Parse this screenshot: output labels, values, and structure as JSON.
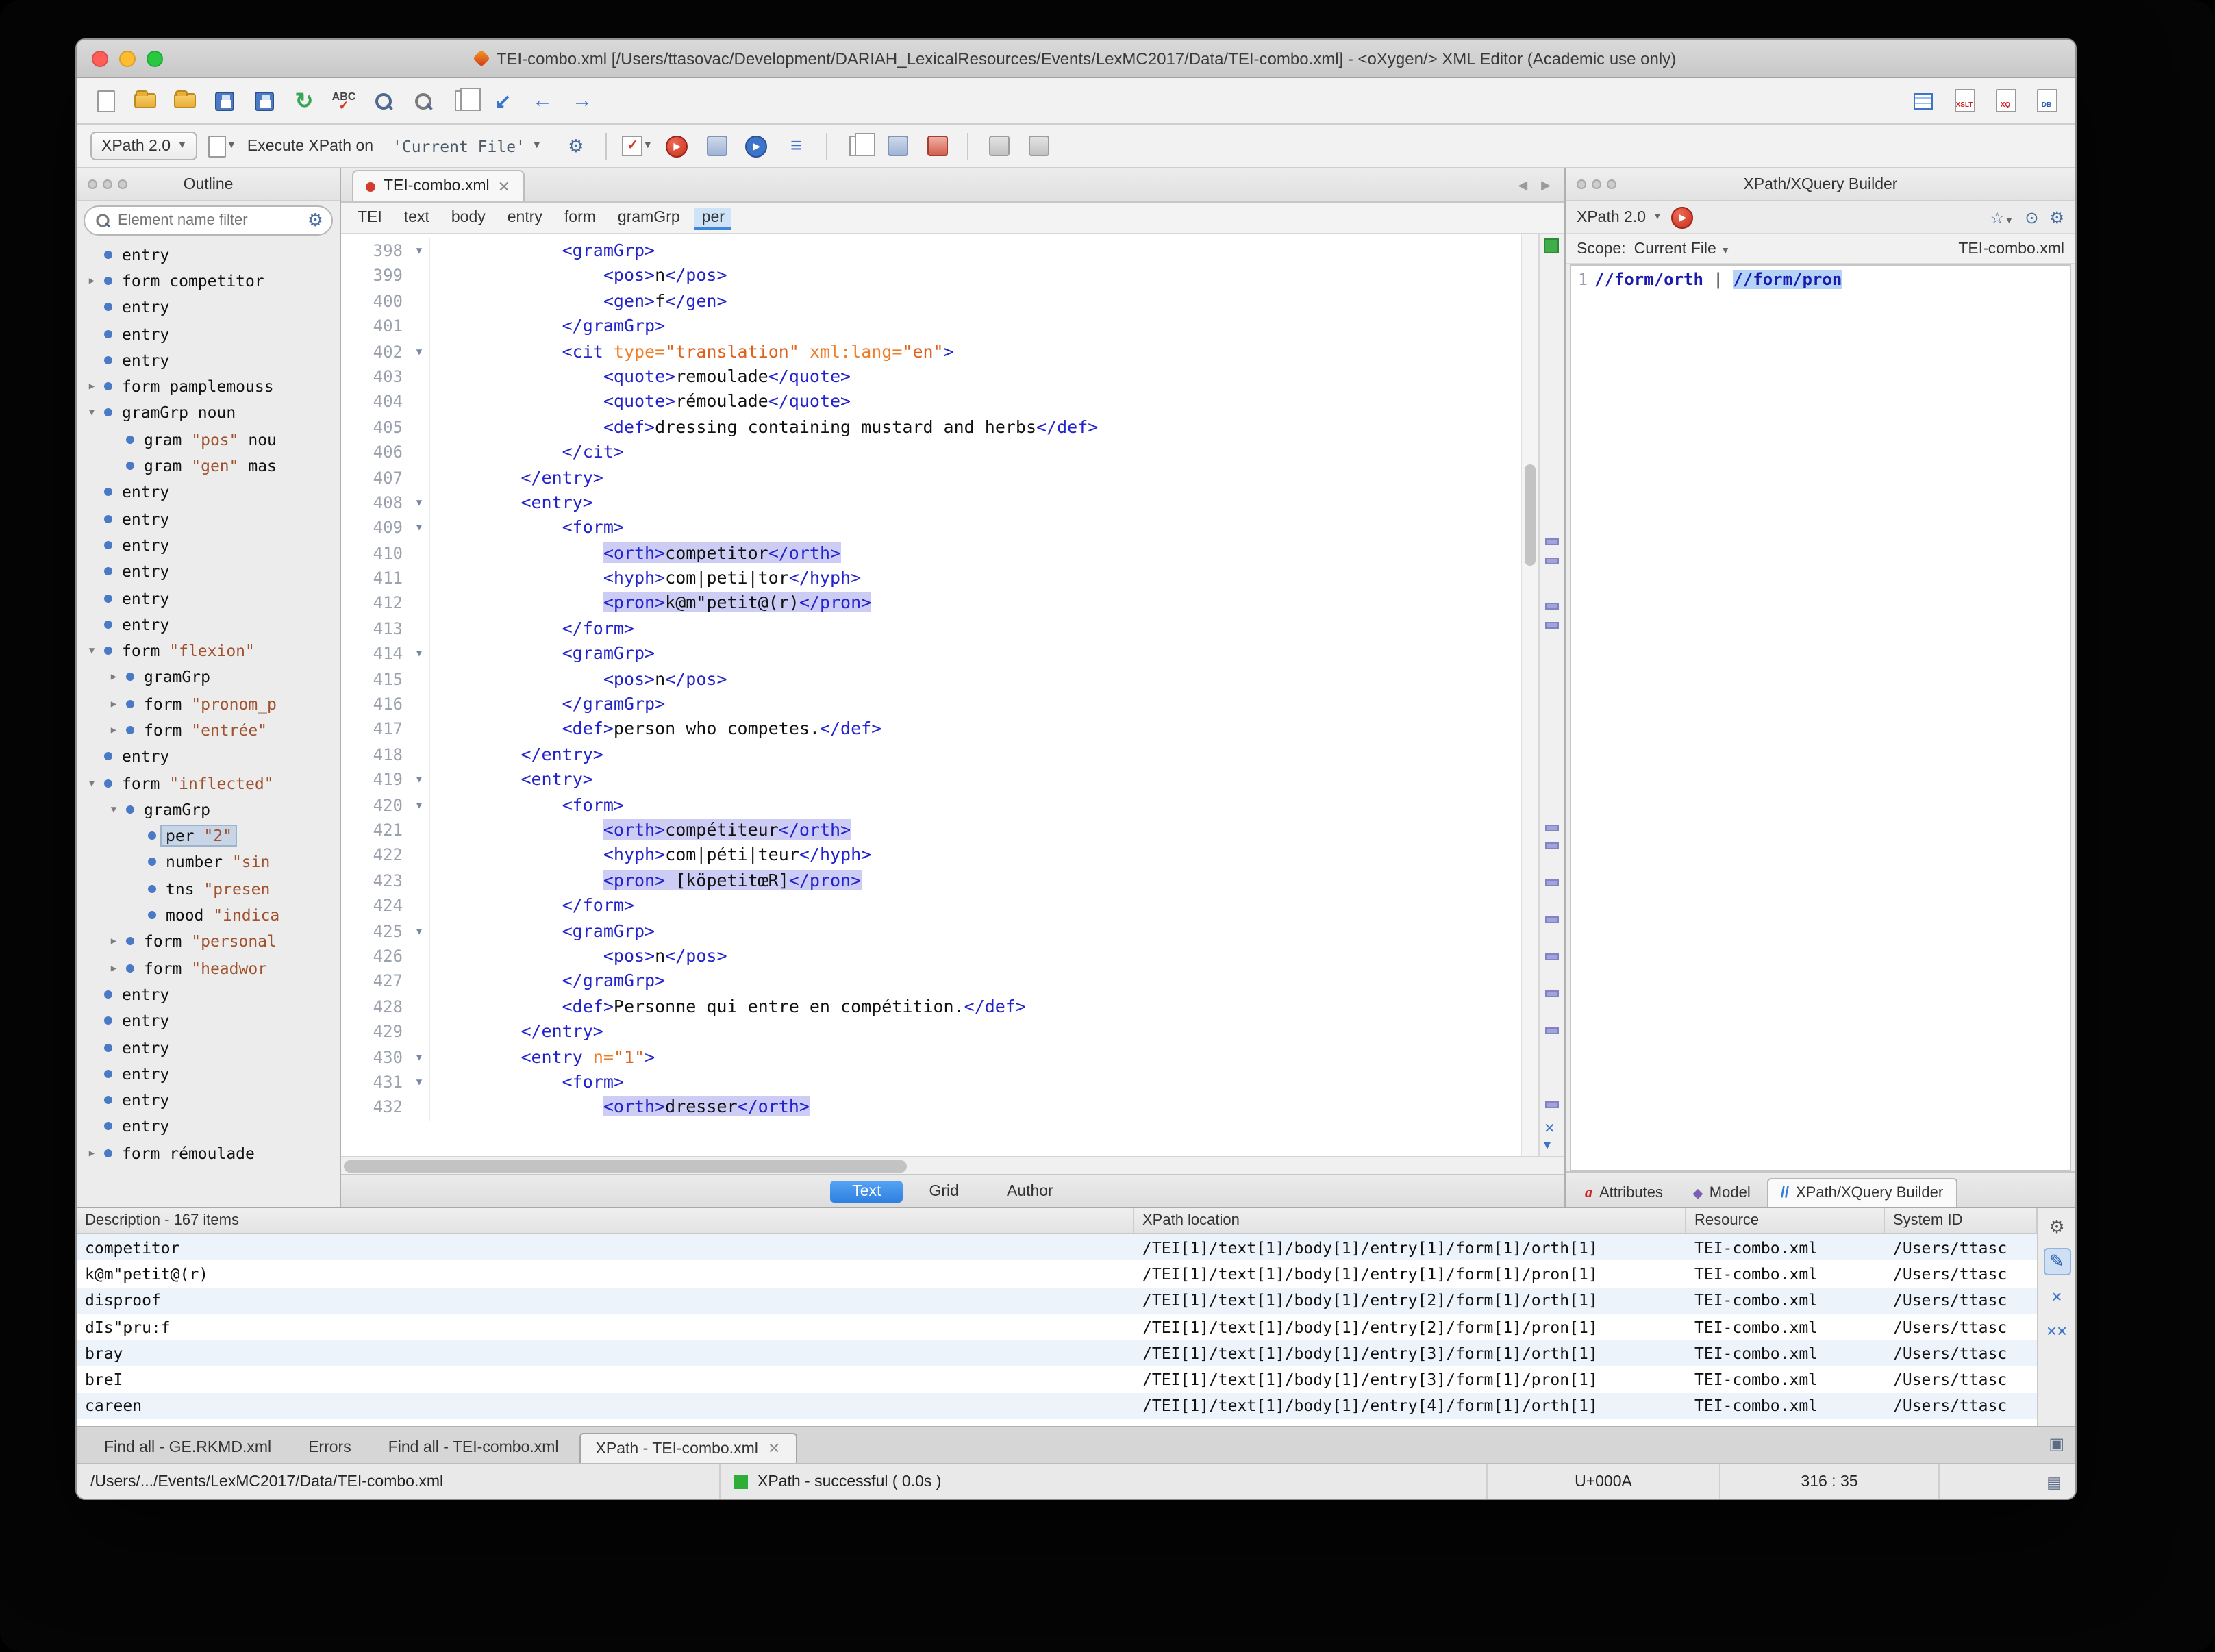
{
  "window": {
    "title": "TEI-combo.xml [/Users/ttasovac/Development/DARIAH_LexicalResources/Events/LexMC2017/Data/TEI-combo.xml] - <oXygen/> XML Editor (Academic use only)"
  },
  "xpath_toolbar": {
    "version_label": "XPath 2.0",
    "execute_label": "Execute XPath on",
    "target_value": "'Current File'"
  },
  "outline": {
    "title": "Outline",
    "filter_placeholder": "Element name filter",
    "items": [
      {
        "indent": 0,
        "arrow": "",
        "name": "entry"
      },
      {
        "indent": 0,
        "arrow": "right",
        "name": "form",
        "text": "competitor"
      },
      {
        "indent": 0,
        "arrow": "",
        "name": "entry"
      },
      {
        "indent": 0,
        "arrow": "",
        "name": "entry"
      },
      {
        "indent": 0,
        "arrow": "",
        "name": "entry"
      },
      {
        "indent": 0,
        "arrow": "right",
        "name": "form",
        "text": "pamplemouss"
      },
      {
        "indent": 0,
        "arrow": "down",
        "name": "gramGrp",
        "text": "noun"
      },
      {
        "indent": 1,
        "arrow": "",
        "name": "gram",
        "quoted": "\"pos\"",
        "text": "nou"
      },
      {
        "indent": 1,
        "arrow": "",
        "name": "gram",
        "quoted": "\"gen\"",
        "text": "mas"
      },
      {
        "indent": 0,
        "arrow": "",
        "name": "entry"
      },
      {
        "indent": 0,
        "arrow": "",
        "name": "entry"
      },
      {
        "indent": 0,
        "arrow": "",
        "name": "entry"
      },
      {
        "indent": 0,
        "arrow": "",
        "name": "entry"
      },
      {
        "indent": 0,
        "arrow": "",
        "name": "entry"
      },
      {
        "indent": 0,
        "arrow": "",
        "name": "entry"
      },
      {
        "indent": 0,
        "arrow": "down",
        "name": "form",
        "quoted": "\"flexion\""
      },
      {
        "indent": 1,
        "arrow": "right",
        "name": "gramGrp"
      },
      {
        "indent": 1,
        "arrow": "right",
        "name": "form",
        "quoted": "\"pronom_p"
      },
      {
        "indent": 1,
        "arrow": "right",
        "name": "form",
        "quoted": "\"entrée\""
      },
      {
        "indent": 0,
        "arrow": "",
        "name": "entry"
      },
      {
        "indent": 0,
        "arrow": "down",
        "name": "form",
        "quoted": "\"inflected\""
      },
      {
        "indent": 1,
        "arrow": "down",
        "name": "gramGrp"
      },
      {
        "indent": 2,
        "arrow": "",
        "name": "per",
        "quoted": "\"2\"",
        "selected": true
      },
      {
        "indent": 2,
        "arrow": "",
        "name": "number",
        "quoted": "\"sin"
      },
      {
        "indent": 2,
        "arrow": "",
        "name": "tns",
        "quoted": "\"presen"
      },
      {
        "indent": 2,
        "arrow": "",
        "name": "mood",
        "quoted": "\"indica"
      },
      {
        "indent": 1,
        "arrow": "right",
        "name": "form",
        "quoted": "\"personal"
      },
      {
        "indent": 1,
        "arrow": "right",
        "name": "form",
        "quoted": "\"headwor"
      },
      {
        "indent": 0,
        "arrow": "",
        "name": "entry"
      },
      {
        "indent": 0,
        "arrow": "",
        "name": "entry"
      },
      {
        "indent": 0,
        "arrow": "",
        "name": "entry"
      },
      {
        "indent": 0,
        "arrow": "",
        "name": "entry"
      },
      {
        "indent": 0,
        "arrow": "",
        "name": "entry"
      },
      {
        "indent": 0,
        "arrow": "",
        "name": "entry"
      },
      {
        "indent": 0,
        "arrow": "right",
        "name": "form",
        "text": "rémoulade"
      }
    ]
  },
  "editor": {
    "tab_label": "TEI-combo.xml",
    "breadcrumb": [
      "TEI",
      "text",
      "body",
      "entry",
      "form",
      "gramGrp",
      "per"
    ],
    "breadcrumb_active": "per",
    "mode_tabs": [
      "Text",
      "Grid",
      "Author"
    ],
    "active_mode": "Text",
    "ruler_marks": [
      33,
      35,
      40,
      42,
      64,
      66,
      70,
      74,
      78,
      82,
      86,
      94
    ],
    "lines": [
      {
        "n": 398,
        "fold": true,
        "seg": [
          [
            "p",
            "            "
          ],
          [
            "t",
            "<gramGrp>"
          ]
        ]
      },
      {
        "n": 399,
        "fold": false,
        "seg": [
          [
            "p",
            "                "
          ],
          [
            "t",
            "<pos>"
          ],
          [
            "p",
            "n"
          ],
          [
            "t",
            "</pos>"
          ]
        ]
      },
      {
        "n": 400,
        "fold": false,
        "seg": [
          [
            "p",
            "                "
          ],
          [
            "t",
            "<gen>"
          ],
          [
            "p",
            "f"
          ],
          [
            "t",
            "</gen>"
          ]
        ]
      },
      {
        "n": 401,
        "fold": false,
        "seg": [
          [
            "p",
            "            "
          ],
          [
            "t",
            "</gramGrp>"
          ]
        ]
      },
      {
        "n": 402,
        "fold": true,
        "seg": [
          [
            "p",
            "            "
          ],
          [
            "t",
            "<cit "
          ],
          [
            "a",
            "type="
          ],
          [
            "v",
            "\"translation\""
          ],
          [
            "p",
            " "
          ],
          [
            "a",
            "xml:lang="
          ],
          [
            "v",
            "\"en\""
          ],
          [
            "t",
            ">"
          ]
        ]
      },
      {
        "n": 403,
        "fold": false,
        "seg": [
          [
            "p",
            "                "
          ],
          [
            "t",
            "<quote>"
          ],
          [
            "p",
            "remoulade"
          ],
          [
            "t",
            "</quote>"
          ]
        ]
      },
      {
        "n": 404,
        "fold": false,
        "seg": [
          [
            "p",
            "                "
          ],
          [
            "t",
            "<quote>"
          ],
          [
            "p",
            "rémoulade"
          ],
          [
            "t",
            "</quote>"
          ]
        ]
      },
      {
        "n": 405,
        "fold": false,
        "seg": [
          [
            "p",
            "                "
          ],
          [
            "t",
            "<def>"
          ],
          [
            "p",
            "dressing containing mustard and herbs"
          ],
          [
            "t",
            "</def>"
          ]
        ]
      },
      {
        "n": 406,
        "fold": false,
        "seg": [
          [
            "p",
            "            "
          ],
          [
            "t",
            "</cit>"
          ]
        ]
      },
      {
        "n": 407,
        "fold": false,
        "seg": [
          [
            "p",
            "        "
          ],
          [
            "t",
            "</entry>"
          ]
        ]
      },
      {
        "n": 408,
        "fold": true,
        "seg": [
          [
            "p",
            "        "
          ],
          [
            "t",
            "<entry>"
          ]
        ]
      },
      {
        "n": 409,
        "fold": true,
        "seg": [
          [
            "p",
            "            "
          ],
          [
            "t",
            "<form>"
          ]
        ]
      },
      {
        "n": 410,
        "fold": false,
        "seg": [
          [
            "p",
            "                "
          ],
          [
            "ht",
            "<orth>"
          ],
          [
            "hp",
            "competitor"
          ],
          [
            "ht",
            "</orth>"
          ]
        ]
      },
      {
        "n": 411,
        "fold": false,
        "seg": [
          [
            "p",
            "                "
          ],
          [
            "t",
            "<hyph>"
          ],
          [
            "p",
            "com|peti|tor"
          ],
          [
            "t",
            "</hyph>"
          ]
        ]
      },
      {
        "n": 412,
        "fold": false,
        "seg": [
          [
            "p",
            "                "
          ],
          [
            "ht",
            "<pron>"
          ],
          [
            "hp",
            "k@m\"petit@(r)"
          ],
          [
            "ht",
            "</pron>"
          ]
        ]
      },
      {
        "n": 413,
        "fold": false,
        "seg": [
          [
            "p",
            "            "
          ],
          [
            "t",
            "</form>"
          ]
        ]
      },
      {
        "n": 414,
        "fold": true,
        "seg": [
          [
            "p",
            "            "
          ],
          [
            "t",
            "<gramGrp>"
          ]
        ]
      },
      {
        "n": 415,
        "fold": false,
        "seg": [
          [
            "p",
            "                "
          ],
          [
            "t",
            "<pos>"
          ],
          [
            "p",
            "n"
          ],
          [
            "t",
            "</pos>"
          ]
        ]
      },
      {
        "n": 416,
        "fold": false,
        "seg": [
          [
            "p",
            "            "
          ],
          [
            "t",
            "</gramGrp>"
          ]
        ]
      },
      {
        "n": 417,
        "fold": false,
        "seg": [
          [
            "p",
            "            "
          ],
          [
            "t",
            "<def>"
          ],
          [
            "p",
            "person who competes."
          ],
          [
            "t",
            "</def>"
          ]
        ]
      },
      {
        "n": 418,
        "fold": false,
        "seg": [
          [
            "p",
            "        "
          ],
          [
            "t",
            "</entry>"
          ]
        ]
      },
      {
        "n": 419,
        "fold": true,
        "seg": [
          [
            "p",
            "        "
          ],
          [
            "t",
            "<entry>"
          ]
        ]
      },
      {
        "n": 420,
        "fold": true,
        "seg": [
          [
            "p",
            "            "
          ],
          [
            "t",
            "<form>"
          ]
        ]
      },
      {
        "n": 421,
        "fold": false,
        "seg": [
          [
            "p",
            "                "
          ],
          [
            "ht",
            "<orth>"
          ],
          [
            "hp",
            "compétiteur"
          ],
          [
            "ht",
            "</orth>"
          ]
        ]
      },
      {
        "n": 422,
        "fold": false,
        "seg": [
          [
            "p",
            "                "
          ],
          [
            "t",
            "<hyph>"
          ],
          [
            "p",
            "com|péti|teur"
          ],
          [
            "t",
            "</hyph>"
          ]
        ]
      },
      {
        "n": 423,
        "fold": false,
        "seg": [
          [
            "p",
            "                "
          ],
          [
            "ht",
            "<pron>"
          ],
          [
            "hp",
            " [köpetitœR]"
          ],
          [
            "ht",
            "</pron>"
          ]
        ]
      },
      {
        "n": 424,
        "fold": false,
        "seg": [
          [
            "p",
            "            "
          ],
          [
            "t",
            "</form>"
          ]
        ]
      },
      {
        "n": 425,
        "fold": true,
        "seg": [
          [
            "p",
            "            "
          ],
          [
            "t",
            "<gramGrp>"
          ]
        ]
      },
      {
        "n": 426,
        "fold": false,
        "seg": [
          [
            "p",
            "                "
          ],
          [
            "t",
            "<pos>"
          ],
          [
            "p",
            "n"
          ],
          [
            "t",
            "</pos>"
          ]
        ]
      },
      {
        "n": 427,
        "fold": false,
        "seg": [
          [
            "p",
            "            "
          ],
          [
            "t",
            "</gramGrp>"
          ]
        ]
      },
      {
        "n": 428,
        "fold": false,
        "seg": [
          [
            "p",
            "            "
          ],
          [
            "t",
            "<def>"
          ],
          [
            "p",
            "Personne qui entre en compétition."
          ],
          [
            "t",
            "</def>"
          ]
        ]
      },
      {
        "n": 429,
        "fold": false,
        "seg": [
          [
            "p",
            "        "
          ],
          [
            "t",
            "</entry>"
          ]
        ]
      },
      {
        "n": 430,
        "fold": true,
        "seg": [
          [
            "p",
            "        "
          ],
          [
            "t",
            "<entry "
          ],
          [
            "a",
            "n="
          ],
          [
            "v",
            "\"1\""
          ],
          [
            "t",
            ">"
          ]
        ]
      },
      {
        "n": 431,
        "fold": true,
        "seg": [
          [
            "p",
            "            "
          ],
          [
            "t",
            "<form>"
          ]
        ]
      },
      {
        "n": 432,
        "fold": false,
        "seg": [
          [
            "p",
            "                "
          ],
          [
            "ht",
            "<orth>"
          ],
          [
            "hp",
            "dresser"
          ],
          [
            "ht",
            "</orth>"
          ]
        ]
      }
    ]
  },
  "xpath_builder": {
    "panel_title": "XPath/XQuery Builder",
    "version_label": "XPath 2.0",
    "scope_label": "Scope:",
    "scope_value": "Current File",
    "scope_file": "TEI-combo.xml",
    "line_number": "1",
    "expression_parts": [
      {
        "text": "//form/orth",
        "selected": false,
        "plain": false
      },
      {
        "text": " | ",
        "selected": false,
        "plain": true
      },
      {
        "text": "//form/pron",
        "selected": true,
        "plain": false
      }
    ],
    "tabs": [
      {
        "label": "Attributes",
        "icon": "a",
        "active": false
      },
      {
        "label": "Model",
        "icon": "model",
        "active": false
      },
      {
        "label": "XPath/XQuery Builder",
        "icon": "xpath",
        "active": true
      }
    ]
  },
  "results": {
    "header": {
      "description": "Description - 167 items",
      "xpath_location": "XPath location",
      "resource": "Resource",
      "system_id": "System ID"
    },
    "rows": [
      {
        "description": "competitor",
        "xpath": "/TEI[1]/text[1]/body[1]/entry[1]/form[1]/orth[1]",
        "resource": "TEI-combo.xml",
        "system_id": "/Users/ttasc"
      },
      {
        "description": "k@m\"petit@(r)",
        "xpath": "/TEI[1]/text[1]/body[1]/entry[1]/form[1]/pron[1]",
        "resource": "TEI-combo.xml",
        "system_id": "/Users/ttasc"
      },
      {
        "description": "disproof",
        "xpath": "/TEI[1]/text[1]/body[1]/entry[2]/form[1]/orth[1]",
        "resource": "TEI-combo.xml",
        "system_id": "/Users/ttasc"
      },
      {
        "description": "dIs\"pru:f",
        "xpath": "/TEI[1]/text[1]/body[1]/entry[2]/form[1]/pron[1]",
        "resource": "TEI-combo.xml",
        "system_id": "/Users/ttasc"
      },
      {
        "description": "bray",
        "xpath": "/TEI[1]/text[1]/body[1]/entry[3]/form[1]/orth[1]",
        "resource": "TEI-combo.xml",
        "system_id": "/Users/ttasc"
      },
      {
        "description": "breI",
        "xpath": "/TEI[1]/text[1]/body[1]/entry[3]/form[1]/pron[1]",
        "resource": "TEI-combo.xml",
        "system_id": "/Users/ttasc"
      },
      {
        "description": "careen",
        "xpath": "/TEI[1]/text[1]/body[1]/entry[4]/form[1]/orth[1]",
        "resource": "TEI-combo.xml",
        "system_id": "/Users/ttasc"
      }
    ]
  },
  "bottom_tabs": [
    {
      "label": "Find all - GE.RKMD.xml",
      "active": false,
      "closable": false
    },
    {
      "label": "Errors",
      "active": false,
      "closable": false
    },
    {
      "label": "Find all - TEI-combo.xml",
      "active": false,
      "closable": false
    },
    {
      "label": "XPath - TEI-combo.xml",
      "active": true,
      "closable": true
    }
  ],
  "status_bar": {
    "file_path": "/Users/.../Events/LexMC2017/Data/TEI-combo.xml",
    "status_message": "XPath - successful ( 0.0s )",
    "unicode_codepoint": "U+000A",
    "caret_position": "316 : 35"
  }
}
